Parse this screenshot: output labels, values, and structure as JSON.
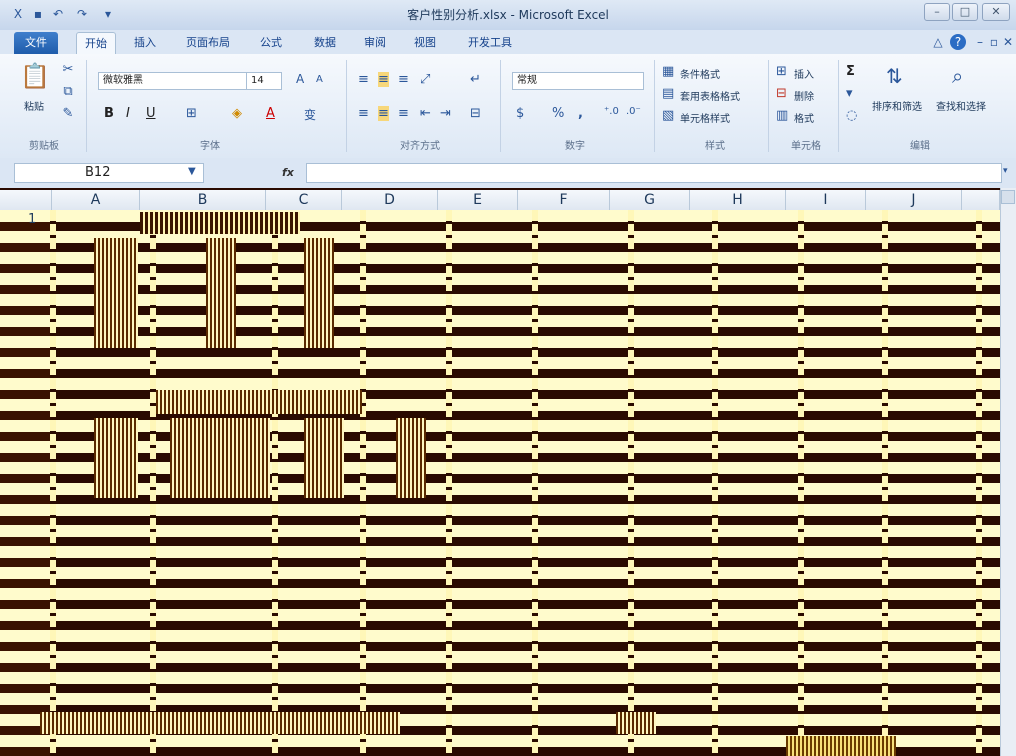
{
  "window": {
    "title": "客户性别分析.xlsx - Microsoft Excel",
    "controls": [
      "min",
      "max",
      "close"
    ]
  },
  "tabs": [
    "文件",
    "开始",
    "插入",
    "页面布局",
    "公式",
    "数据",
    "审阅",
    "视图",
    "开发工具"
  ],
  "ribbon": {
    "clipboard": {
      "paste": "粘贴",
      "label": "剪贴板"
    },
    "font": {
      "name": "微软雅黑",
      "size": "14",
      "bold": "B",
      "italic": "I",
      "underline": "U",
      "grow": "A",
      "shrink": "A",
      "color": "A",
      "wen": "变",
      "label": "字体"
    },
    "alignment": {
      "label": "对齐方式"
    },
    "number": {
      "format": "常规",
      "percent": "%",
      "comma": ",",
      "label": "数字"
    },
    "styles": {
      "conditional": "条件格式",
      "table": "套用表格格式",
      "cell": "单元格样式",
      "label": "样式"
    },
    "cells": {
      "insert": "插入",
      "delete": "删除",
      "format": "格式",
      "label": "单元格"
    },
    "editing": {
      "sigma": "Σ",
      "sort": "排序和筛选",
      "find": "查找和选择",
      "label": "编辑"
    }
  },
  "formula_bar": {
    "name_box": "B12",
    "fx": "fx"
  },
  "columns": [
    "A",
    "B",
    "C",
    "D",
    "E",
    "F",
    "G",
    "H",
    "I",
    "J"
  ],
  "rows": [
    "1"
  ]
}
